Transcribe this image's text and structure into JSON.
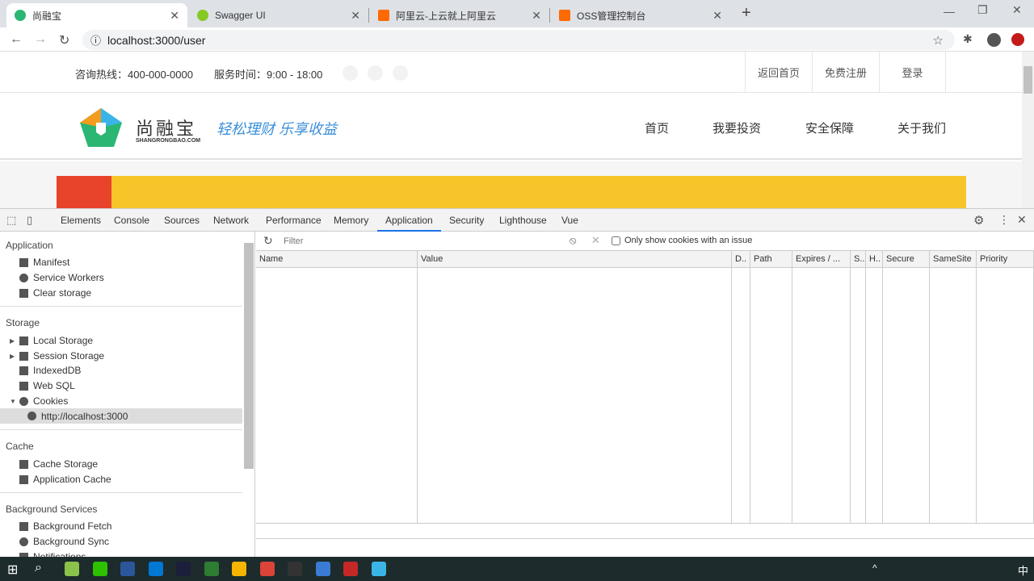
{
  "browser": {
    "tabs": [
      {
        "title": "尚融宝",
        "active": true
      },
      {
        "title": "Swagger UI"
      },
      {
        "title": "阿里云-上云就上阿里云"
      },
      {
        "title": "OSS管理控制台"
      }
    ],
    "url": "localhost:3000/user"
  },
  "site": {
    "hotline": "咨询热线：400-000-0000",
    "hours": "服务时间：9:00 - 18:00",
    "top_links": [
      "返回首页",
      "免费注册",
      "登录"
    ],
    "logo_name": "尚融宝",
    "logo_domain": "SHANGRONGBAO.COM",
    "slogan": "轻松理财 乐享收益",
    "nav": [
      "首页",
      "我要投资",
      "安全保障",
      "关于我们"
    ]
  },
  "devtools": {
    "tabs": [
      "Elements",
      "Console",
      "Sources",
      "Network",
      "Performance",
      "Memory",
      "Application",
      "Security",
      "Lighthouse",
      "Vue"
    ],
    "active_tab": "Application",
    "sidebar": {
      "application": {
        "title": "Application",
        "items": [
          "Manifest",
          "Service Workers",
          "Clear storage"
        ]
      },
      "storage": {
        "title": "Storage",
        "items": [
          "Local Storage",
          "Session Storage",
          "IndexedDB",
          "Web SQL",
          "Cookies"
        ],
        "cookie_child": "http://localhost:3000"
      },
      "cache": {
        "title": "Cache",
        "items": [
          "Cache Storage",
          "Application Cache"
        ]
      },
      "background": {
        "title": "Background Services",
        "items": [
          "Background Fetch",
          "Background Sync",
          "Notifications"
        ]
      }
    },
    "filter_placeholder": "Filter",
    "only_issue_label": "Only show cookies with an issue",
    "columns": [
      "Name",
      "Value",
      "D..",
      "Path",
      "Expires / ...",
      "S..",
      "H..",
      "Secure",
      "SameSite",
      "Priority"
    ]
  },
  "taskbar": {
    "ime": "中"
  }
}
